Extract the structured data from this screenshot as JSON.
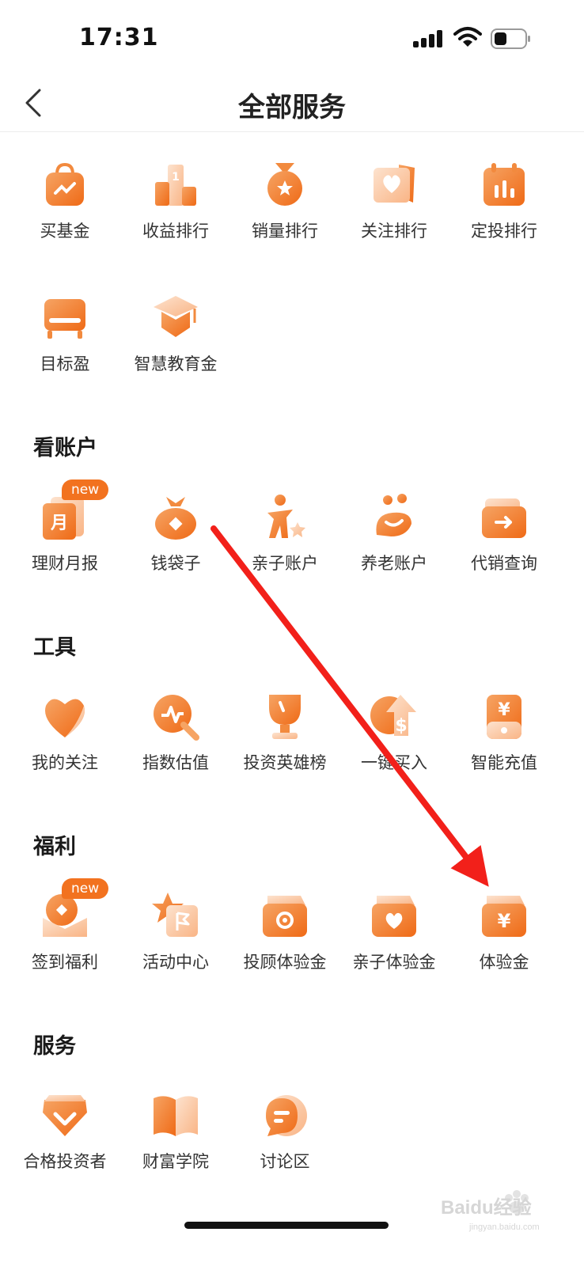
{
  "status_bar": {
    "time": "17:31"
  },
  "nav": {
    "title": "全部服务"
  },
  "sections": [
    {
      "title": "",
      "items": [
        {
          "label": "买基金",
          "icon": "shopping-bag-icon"
        },
        {
          "label": "收益排行",
          "icon": "podium-icon"
        },
        {
          "label": "销量排行",
          "icon": "medal-icon"
        },
        {
          "label": "关注排行",
          "icon": "heart-flag-icon"
        },
        {
          "label": "定投排行",
          "icon": "calendar-chart-icon"
        },
        {
          "label": "目标盈",
          "icon": "target-board-icon"
        },
        {
          "label": "智慧教育金",
          "icon": "graduation-cap-icon"
        }
      ]
    },
    {
      "title": "看账户",
      "items": [
        {
          "label": "理财月报",
          "icon": "monthly-report-icon",
          "badge": "new",
          "glyph": "月"
        },
        {
          "label": "钱袋子",
          "icon": "money-bag-icon"
        },
        {
          "label": "亲子账户",
          "icon": "parent-child-icon"
        },
        {
          "label": "养老账户",
          "icon": "elderly-icon"
        },
        {
          "label": "代销查询",
          "icon": "wallet-arrow-icon"
        }
      ]
    },
    {
      "title": "工具",
      "items": [
        {
          "label": "我的关注",
          "icon": "heart-icon"
        },
        {
          "label": "指数估值",
          "icon": "index-search-icon"
        },
        {
          "label": "投资英雄榜",
          "icon": "trophy-icon"
        },
        {
          "label": "一键买入",
          "icon": "dollar-upload-icon",
          "glyph": "$"
        },
        {
          "label": "智能充值",
          "icon": "yuan-card-icon",
          "glyph": "¥"
        }
      ]
    },
    {
      "title": "福利",
      "items": [
        {
          "label": "签到福利",
          "icon": "red-envelope-icon",
          "badge": "new"
        },
        {
          "label": "活动中心",
          "icon": "star-flag-icon"
        },
        {
          "label": "投顾体验金",
          "icon": "ticket-target-icon"
        },
        {
          "label": "亲子体验金",
          "icon": "ticket-heart-icon"
        },
        {
          "label": "体验金",
          "icon": "ticket-yuan-icon",
          "glyph": "¥"
        }
      ]
    },
    {
      "title": "服务",
      "items": [
        {
          "label": "合格投资者",
          "icon": "diamond-check-icon"
        },
        {
          "label": "财富学院",
          "icon": "open-book-icon"
        },
        {
          "label": "讨论区",
          "icon": "chat-bubble-icon"
        }
      ]
    }
  ],
  "watermark": {
    "text": "Baidu经验",
    "sub": "jingyan.baidu.com"
  },
  "colors": {
    "accent": "#f2721f",
    "icon_light": "#fbc9a3",
    "annotation_arrow": "#f2201a"
  }
}
